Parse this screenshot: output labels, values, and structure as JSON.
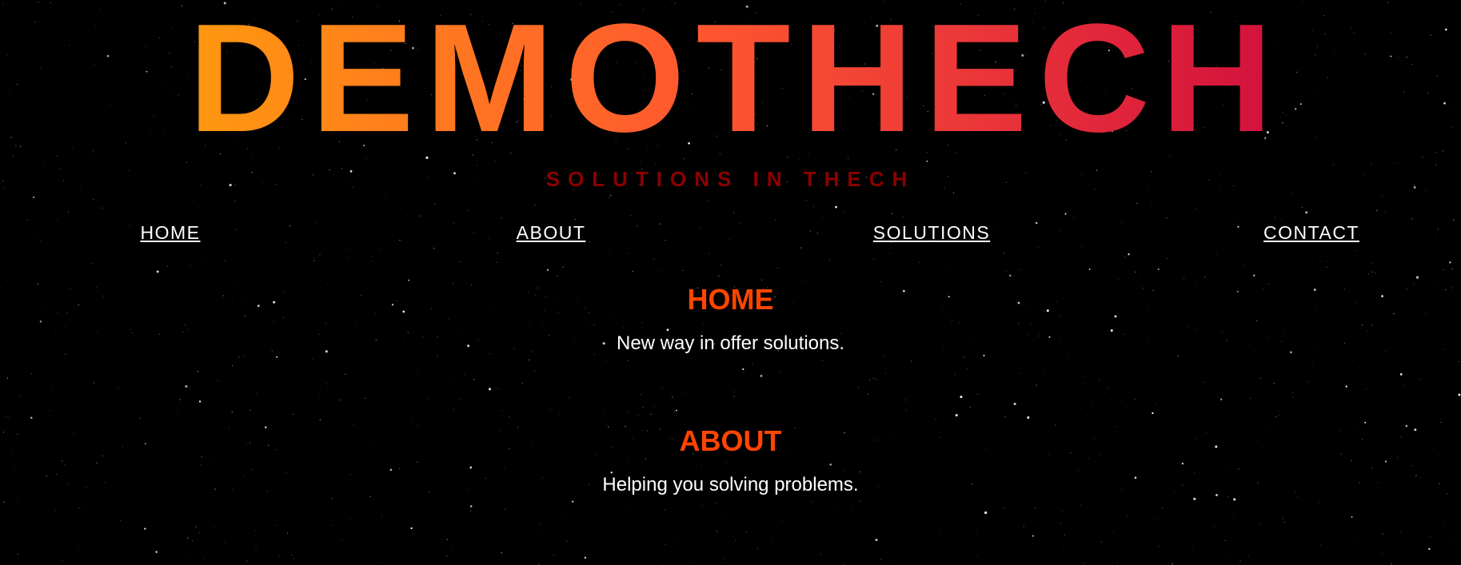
{
  "header": {
    "logo_text": "DEMOTHECH",
    "tagline": "SOLUTIONS IN THECH"
  },
  "nav": {
    "items": [
      {
        "label": "HOME"
      },
      {
        "label": "ABOUT"
      },
      {
        "label": "SOLUTIONS"
      },
      {
        "label": "CONTACT"
      }
    ]
  },
  "sections": [
    {
      "title": "HOME",
      "text": "New way in offer solutions."
    },
    {
      "title": "ABOUT",
      "text": "Helping you solving problems."
    }
  ],
  "colors": {
    "background": "#000000",
    "logo_gradient_start": "#ff9a0f",
    "logo_gradient_end": "#d2103c",
    "tagline": "#8b0000",
    "section_title": "#ff4500",
    "text": "#ffffff"
  }
}
